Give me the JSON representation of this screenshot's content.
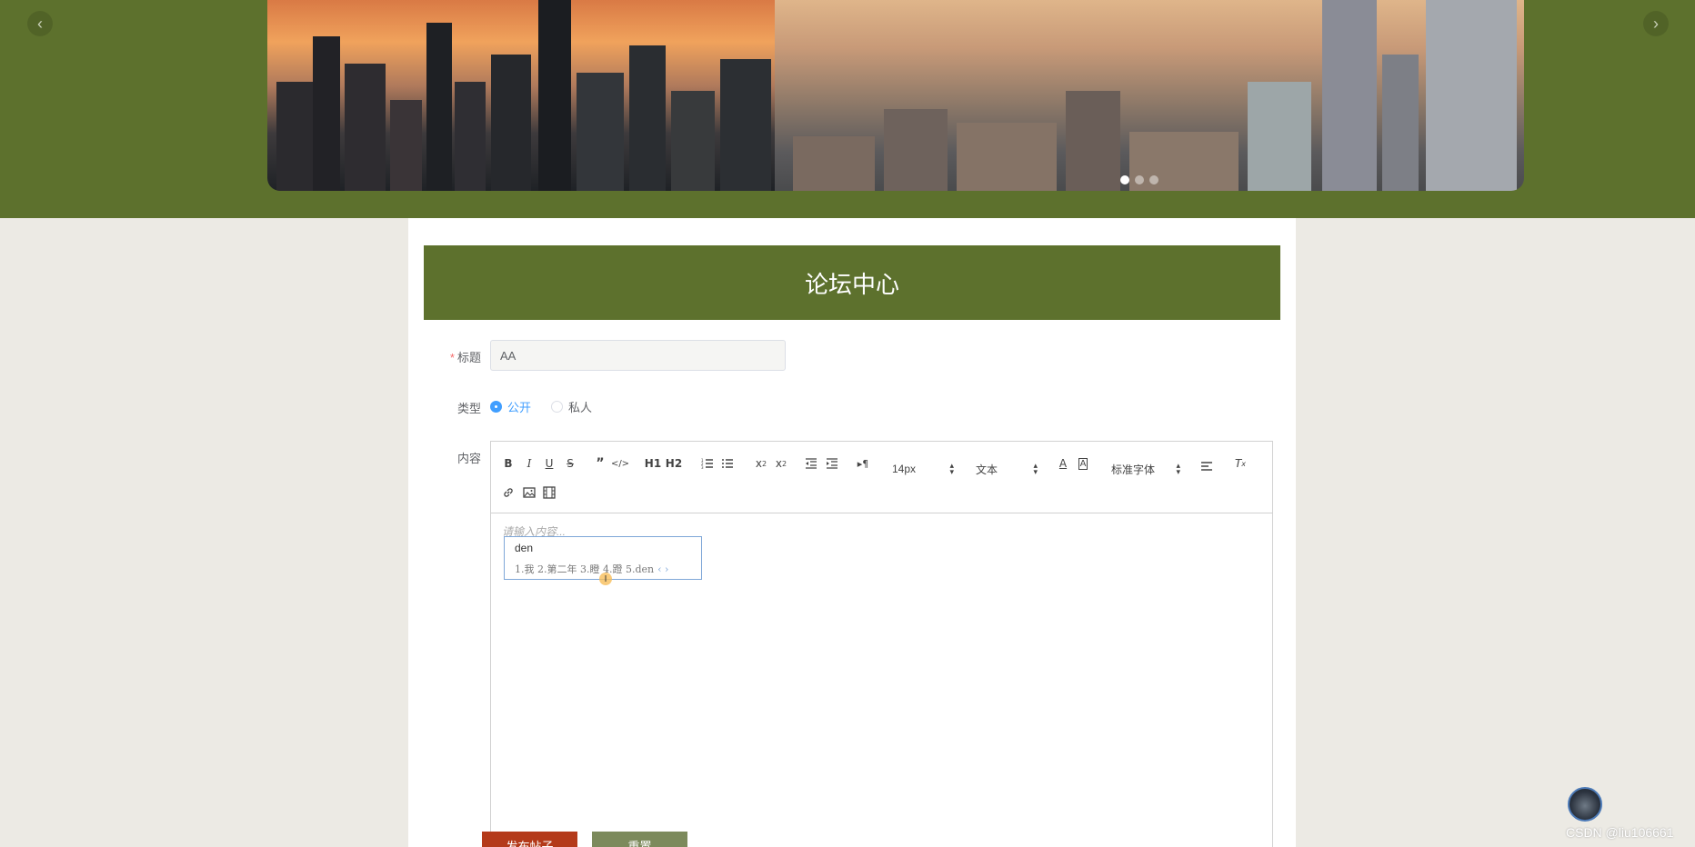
{
  "carousel": {
    "prev_glyph": "‹",
    "next_glyph": "›",
    "slide_count": 3,
    "active_slide": 1
  },
  "forum": {
    "title": "论坛中心"
  },
  "form": {
    "title_label": "标题",
    "title_value": "AA",
    "type_label": "类型",
    "type_options": [
      {
        "label": "公开",
        "checked": true
      },
      {
        "label": "私人",
        "checked": false
      }
    ],
    "content_label": "内容"
  },
  "editor": {
    "font_size": "14px",
    "header_select": "文本",
    "font_family": "标准字体",
    "placeholder": "请输入内容...",
    "toolbar_text": {
      "h1": "H1",
      "h2": "H2"
    }
  },
  "ime": {
    "input": "den",
    "candidates": "1.我 2.第二年 3.瞪 4.蹬 5.den",
    "pager": "‹ ›"
  },
  "buttons": {
    "publish": "发布帖子",
    "reset": "重置"
  },
  "watermark": "CSDN @liu106661",
  "colors": {
    "brand_green": "#5d712d",
    "publish_red": "#b43a1a",
    "reset_green": "#7c8a5c",
    "radio_blue": "#409eff"
  }
}
